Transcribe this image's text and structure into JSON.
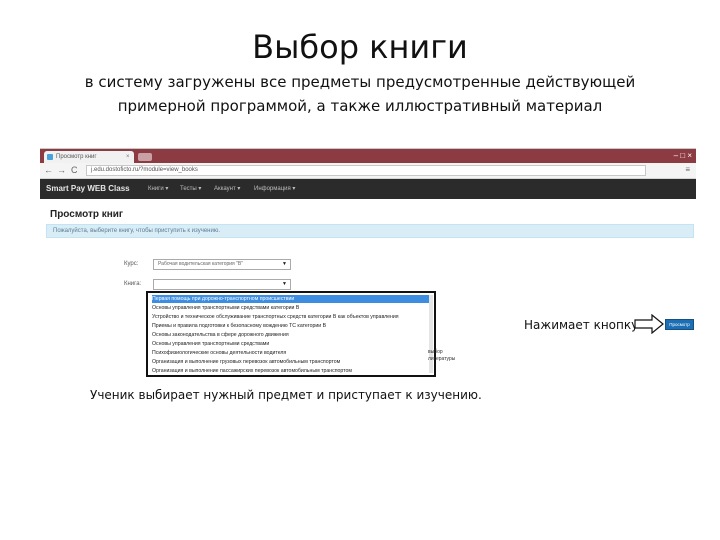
{
  "slide": {
    "title": "Выбор книги",
    "subtitle": "в систему загружены все предметы предусмотренные действующей примерной программой, а также иллюстративный материал",
    "caption_button": "Нажимает кнопку",
    "caption_bottom": "Ученик выбирает нужный предмет и приступает к изучению."
  },
  "browser": {
    "tab_title": "Просмотр книг",
    "tab_close": "×",
    "window_controls": "–  □  ×",
    "back": "←",
    "forward": "→",
    "reload": "C",
    "url": "j.edu.dostoficto.ru/?module=view_books",
    "menu": "≡"
  },
  "app": {
    "brand": "Smart Pay WEB Class",
    "nav": [
      "Книги ▾",
      "Тесты ▾",
      "Аккаунт ▾",
      "Информация ▾"
    ],
    "page_heading": "Просмотр книг",
    "info_message": "Пожалуйста, выберите книгу, чтобы приступить к изучению.",
    "course_label": "Курс:",
    "course_value": "Рабочая водительская категория \"B\"",
    "book_label": "Книга:",
    "book_value": "",
    "dropdown_items": [
      "Первая помощь при дорожно-транспортном происшествии",
      "Основы управления транспортными средствами категории B",
      "Устройство и техническое обслуживание транспортных средств категории B как объектов управления",
      "Приемы и правила подготовки к безопасному вождению ТС категории B",
      "Основы законодательства в сфере дорожного движения",
      "Основы управления транспортными средствами",
      "Психофизиологические основы деятельности водителя",
      "Организация и выполнение грузовых перевозок автомобильным транспортом",
      "Организация и выполнение пассажирских перевозок автомобильным транспортом"
    ],
    "side_note": "выбор литературы",
    "view_button": "Просмотр"
  }
}
